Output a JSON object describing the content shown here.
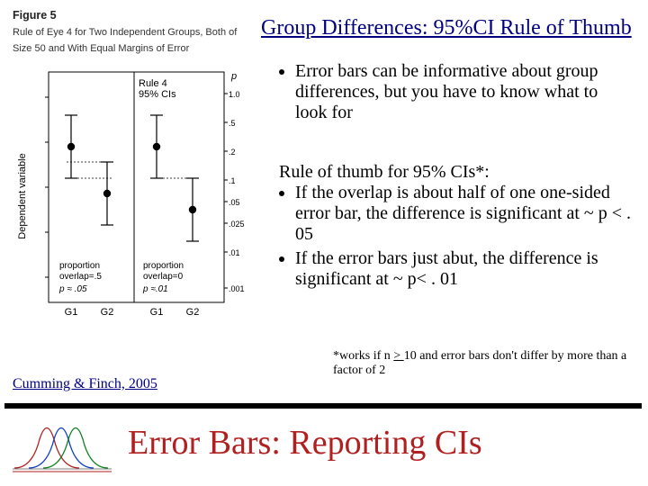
{
  "title": "Group Differences: 95%CI Rule of Thumb",
  "figure": {
    "heading_bold": "Figure 5",
    "heading_rest": "Rule of Eye 4 for Two Independent Groups, Both of Size 50 and With Equal Margins of Error",
    "inner_title_top": "Rule 4",
    "inner_title_bot": "95% CIs",
    "y_axis_label": "Dependent variable",
    "right_axis_label": "p",
    "right_ticks": [
      "1.0",
      ".5",
      ".2",
      ".1",
      ".05",
      ".025",
      ".01",
      ".001"
    ],
    "panel_left": {
      "annot1": "proportion",
      "annot2": "overlap=.5",
      "annot3": "p ≈ .05",
      "x1": "G1",
      "x2": "G2"
    },
    "panel_right": {
      "annot1": "proportion",
      "annot2": "overlap=0",
      "annot3": "p ≈.01",
      "x1": "G1",
      "x2": "G2"
    }
  },
  "citation": "Cumming & Finch, 2005",
  "bullet1": "Error bars can be informative about group differences, but you have to know what to look for",
  "rule_intro": "Rule of thumb for 95% CIs*:",
  "rule1": "If the overlap is about half of one one-sided error bar, the difference is significant at ~ p < . 05",
  "rule2": "If the error bars just abut, the difference is significant at ~ p< . 01",
  "footnote1": "*works if n ",
  "footnote_ge": "> ",
  "footnote2": "10 and error bars don't differ by more than a factor of 2",
  "bottom_title": "Error Bars: Reporting CIs",
  "chart_data": {
    "type": "errorbar",
    "description": "Two panels each with two groups (G1, G2) showing 95% CI error bars around means to illustrate overlap rules of eye.",
    "panels": [
      {
        "name": "overlap_half",
        "groups": [
          "G1",
          "G2"
        ],
        "means": [
          44,
          32
        ],
        "ci_half_width": [
          8,
          8
        ],
        "overlap_proportion": 0.5,
        "approx_p": 0.05
      },
      {
        "name": "overlap_zero",
        "groups": [
          "G1",
          "G2"
        ],
        "means": [
          44,
          28
        ],
        "ci_half_width": [
          8,
          8
        ],
        "overlap_proportion": 0.0,
        "approx_p": 0.01
      }
    ],
    "right_p_scale": [
      1.0,
      0.5,
      0.2,
      0.1,
      0.05,
      0.025,
      0.01,
      0.001
    ],
    "ylabel": "Dependent variable"
  }
}
